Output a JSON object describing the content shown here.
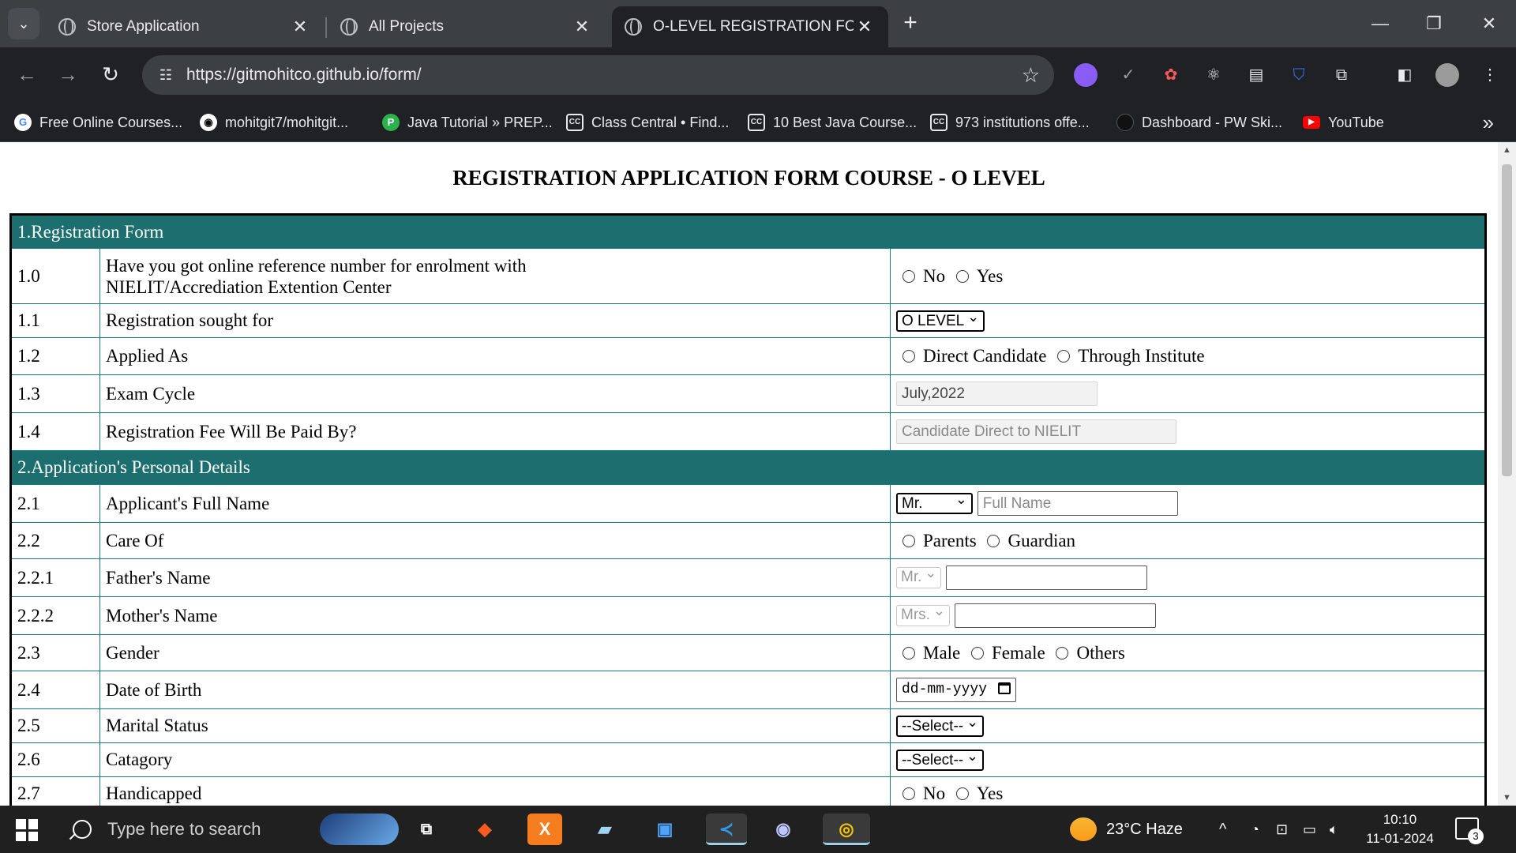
{
  "browser": {
    "tabs": [
      {
        "title": "Store Application",
        "active": false
      },
      {
        "title": "All Projects",
        "active": false
      },
      {
        "title": "O-LEVEL REGISTRATION FORM",
        "active": true
      }
    ],
    "url": "https://gitmohitco.github.io/form/",
    "bookmarks": [
      {
        "label": "Free Online Courses...",
        "icon": "google-icon"
      },
      {
        "label": "mohitgit7/mohitgit...",
        "icon": "github-icon"
      },
      {
        "label": "Java Tutorial » PREP...",
        "icon": "prepinsta-icon"
      },
      {
        "label": "Class Central • Find...",
        "icon": "classcentral-icon"
      },
      {
        "label": "10 Best Java Course...",
        "icon": "classcentral-icon"
      },
      {
        "label": "973 institutions offe...",
        "icon": "classcentral-icon"
      },
      {
        "label": "Dashboard - PW Ski...",
        "icon": "pwskills-icon"
      },
      {
        "label": "YouTube",
        "icon": "youtube-icon"
      }
    ]
  },
  "form": {
    "title": "REGISTRATION APPLICATION FORM COURSE - O LEVEL",
    "section1": "1.Registration Form",
    "section2": "2.Application's Personal Details",
    "r10": {
      "num": "1.0",
      "label_line1": "Have you got online reference number for enrolment with",
      "label_line2": "NIELIT/Accrediation Extention Center",
      "opt1": "No",
      "opt2": "Yes"
    },
    "r11": {
      "num": "1.1",
      "label": "Registration sought for",
      "select": "O LEVEL"
    },
    "r12": {
      "num": "1.2",
      "label": "Applied As",
      "opt1": "Direct Candidate",
      "opt2": "Through Institute"
    },
    "r13": {
      "num": "1.3",
      "label": "Exam Cycle",
      "value": "July,2022"
    },
    "r14": {
      "num": "1.4",
      "label": "Registration Fee Will Be Paid By?",
      "placeholder": "Candidate Direct to NIELIT"
    },
    "r21": {
      "num": "2.1",
      "label": "Applicant's Full Name",
      "title_select": "Mr.",
      "placeholder": "Full Name"
    },
    "r22": {
      "num": "2.2",
      "label": "Care Of",
      "opt1": "Parents",
      "opt2": "Guardian"
    },
    "r221": {
      "num": "2.2.1",
      "label": "Father's Name",
      "title_select": "Mr."
    },
    "r222": {
      "num": "2.2.2",
      "label": "Mother's Name",
      "title_select": "Mrs."
    },
    "r23": {
      "num": "2.3",
      "label": "Gender",
      "opt1": "Male",
      "opt2": "Female",
      "opt3": "Others"
    },
    "r24": {
      "num": "2.4",
      "label": "Date of Birth",
      "date_placeholder": "dd-mm-yyyy"
    },
    "r25": {
      "num": "2.5",
      "label": "Marital Status",
      "select": "--Select--"
    },
    "r26": {
      "num": "2.6",
      "label": "Catagory",
      "select": "--Select--"
    },
    "r27": {
      "num": "2.7",
      "label": "Handicapped",
      "opt1": "No",
      "opt2": "Yes"
    }
  },
  "taskbar": {
    "search_placeholder": "Type here to search",
    "weather": "23°C  Haze",
    "time": "10:10",
    "date": "11-01-2024",
    "notifications": "3"
  }
}
